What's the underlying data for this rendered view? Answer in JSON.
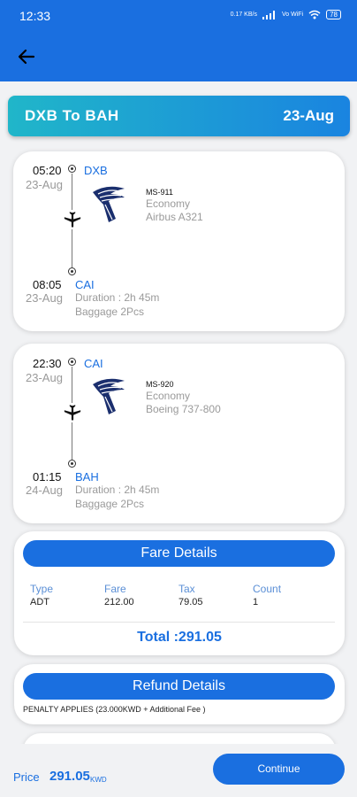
{
  "status_bar": {
    "time": "12:33",
    "speed": "0.17 KB/s",
    "volte": "Vo WiFi",
    "battery": "78"
  },
  "header": {
    "back_icon": "arrow-left-icon"
  },
  "route": {
    "title": "DXB  To  BAH",
    "date": "23-Aug"
  },
  "segments": [
    {
      "dep_time": "05:20",
      "dep_date": "23-Aug",
      "dep_code": "DXB",
      "flight_no": "MS-911",
      "cabin": "Economy",
      "aircraft": "Airbus A321",
      "arr_time": "08:05",
      "arr_date": "23-Aug",
      "arr_code": "CAI",
      "duration": "Duration : 2h 45m",
      "baggage": "Baggage 2Pcs"
    },
    {
      "dep_time": "22:30",
      "dep_date": "23-Aug",
      "dep_code": "CAI",
      "flight_no": "MS-920",
      "cabin": "Economy",
      "aircraft": "Boeing 737-800",
      "arr_time": "01:15",
      "arr_date": "24-Aug",
      "arr_code": "BAH",
      "duration": "Duration : 2h 45m",
      "baggage": "Baggage 2Pcs"
    }
  ],
  "fare": {
    "title": "Fare Details",
    "headers": [
      "Type",
      "Fare",
      "Tax",
      "Count"
    ],
    "row": [
      "ADT",
      "212.00",
      "79.05",
      "1"
    ],
    "total": "Total :291.05"
  },
  "refund": {
    "title": "Refund Details",
    "penalty": "PENALTY APPLIES (23.000KWD  + Additional Fee )"
  },
  "footer": {
    "price_label": "Price",
    "price_value": "291.05",
    "currency": "KWD",
    "continue_label": "Continue"
  },
  "colors": {
    "primary": "#1a6fe0",
    "banner_start": "#20b6c9",
    "banner_end": "#1a84e0"
  }
}
